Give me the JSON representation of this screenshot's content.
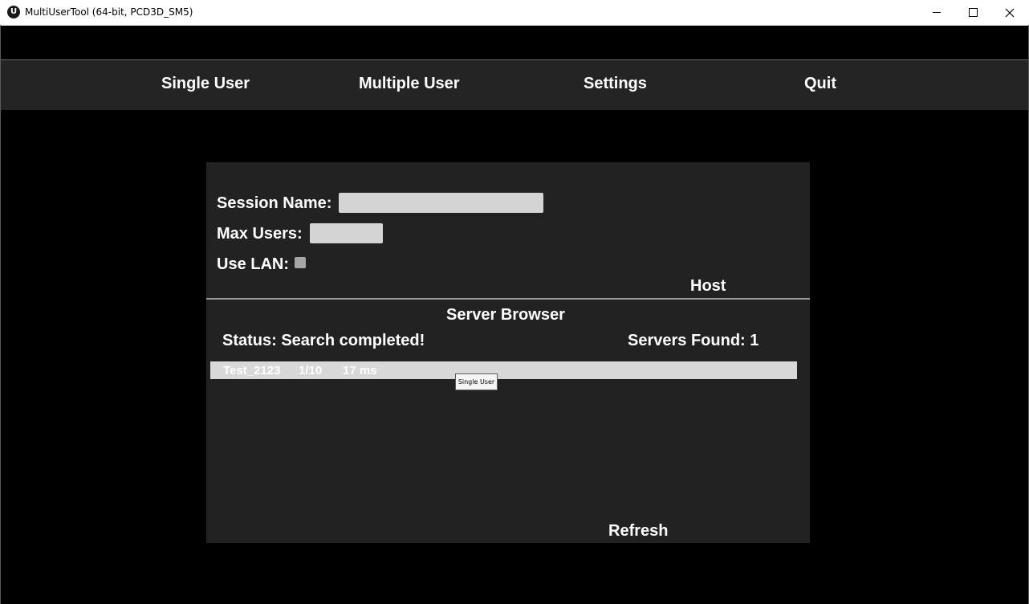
{
  "window": {
    "title": "MultiUserTool (64-bit, PCD3D_SM5)",
    "logo_glyph": "U"
  },
  "menu": {
    "items": [
      {
        "label": "Single User"
      },
      {
        "label": "Multiple User"
      },
      {
        "label": "Settings"
      },
      {
        "label": "Quit"
      }
    ]
  },
  "host_panel": {
    "session_name_label": "Session Name:",
    "session_name_value": "",
    "max_users_label": "Max Users:",
    "max_users_value": "",
    "use_lan_label": "Use LAN:",
    "use_lan_checked": false,
    "host_button": "Host"
  },
  "server_browser": {
    "title": "Server Browser",
    "status_text": "Status: Search completed!",
    "servers_found_text": "Servers Found: 1",
    "servers": [
      {
        "name": "Test_2123",
        "players": "1/10",
        "ping": "17 ms"
      }
    ],
    "refresh_button": "Refresh"
  },
  "tooltip": {
    "text": "Single User"
  },
  "colors": {
    "background": "#000000",
    "menu_bar": "#242424",
    "panel": "#222222",
    "text": "#ffffff",
    "input": "#d4d4d4",
    "server_row": "#d8d8d8"
  }
}
